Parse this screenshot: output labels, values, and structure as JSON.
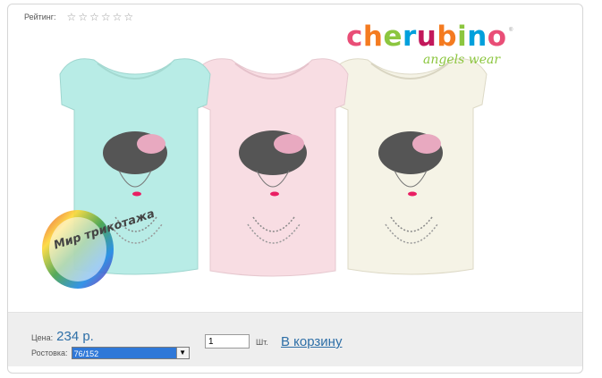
{
  "rating": {
    "label": "Рейтинг:",
    "stars": [
      "☆",
      "☆",
      "☆",
      "☆",
      "☆",
      "☆"
    ]
  },
  "brand": {
    "letters": [
      "c",
      "h",
      "e",
      "r",
      "u",
      "b",
      "i",
      "n",
      "o"
    ],
    "letter_colors": [
      "#e94e77",
      "#f47b20",
      "#8cc63f",
      "#00a0dc",
      "#c2185b",
      "#f47b20",
      "#8cc63f",
      "#00a0dc",
      "#e94e77"
    ],
    "tagline": "angels wear",
    "reg_mark": "®"
  },
  "watermark": {
    "text": "Мир трикотажа"
  },
  "product": {
    "shirt_colors": [
      "#b8ece6",
      "#f8dde3",
      "#f5f3e6"
    ]
  },
  "purchase": {
    "price_label": "Цена:",
    "price_value": "234 р.",
    "size_label": "Ростовка:",
    "size_selected": "76/152",
    "quantity": "1",
    "quantity_unit": "Шт.",
    "cart_link": "В корзину"
  }
}
